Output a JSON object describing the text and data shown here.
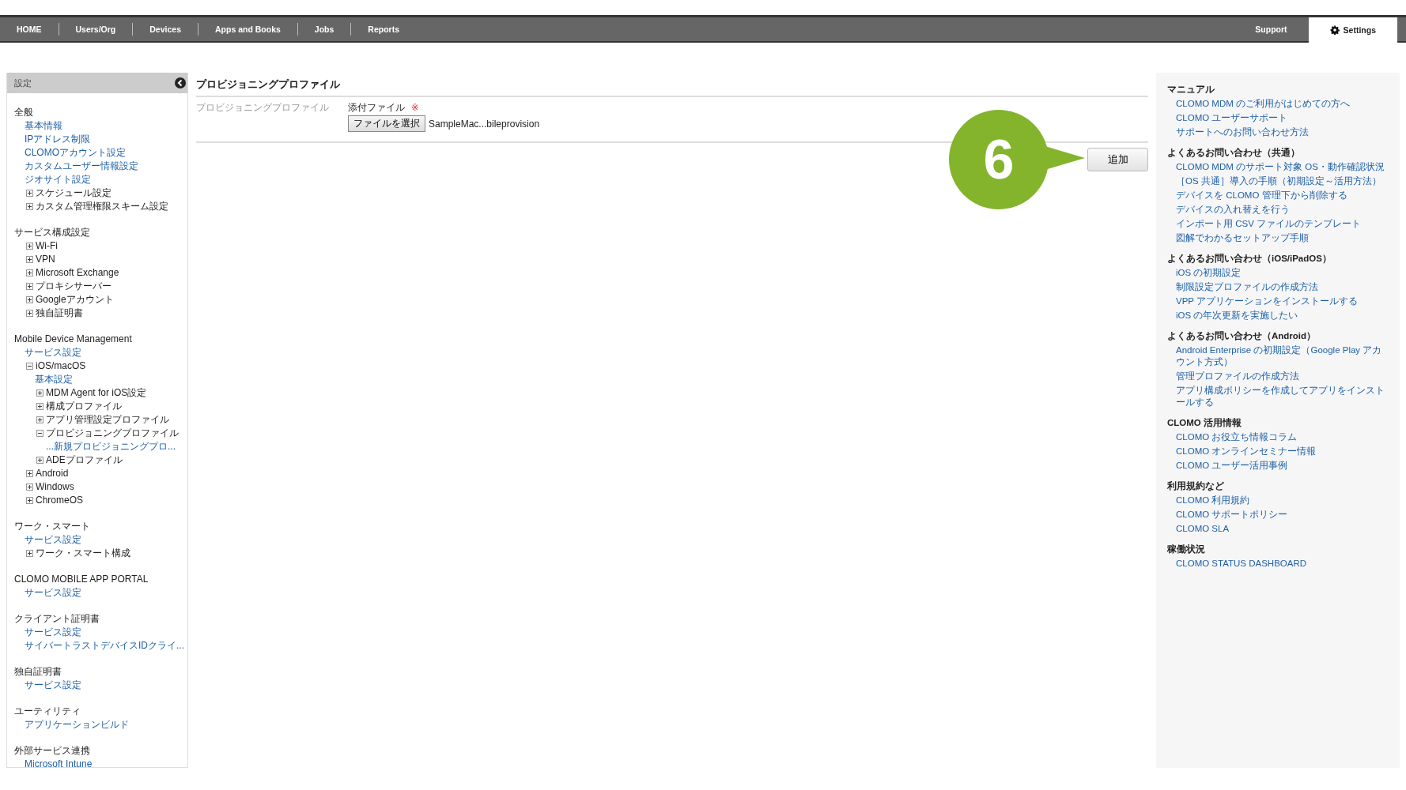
{
  "nav": {
    "tabs": [
      {
        "label": "HOME",
        "selected": false
      },
      {
        "label": "Users/Org",
        "selected": false
      },
      {
        "label": "Devices",
        "selected": false
      },
      {
        "label": "Apps and Books",
        "selected": false
      },
      {
        "label": "Jobs",
        "selected": false
      },
      {
        "label": "Reports",
        "selected": false
      }
    ],
    "right_tabs": [
      {
        "label": "Support",
        "selected": false,
        "kind": "plain"
      },
      {
        "label": "Settings",
        "selected": true,
        "kind": "settings"
      }
    ]
  },
  "sidebar": {
    "title": "設定",
    "sections": [
      {
        "title": "全般",
        "items": [
          {
            "kind": "link",
            "label": "基本情報"
          },
          {
            "kind": "link",
            "label": "IPアドレス制限"
          },
          {
            "kind": "link",
            "label": "CLOMOアカウント設定"
          },
          {
            "kind": "link",
            "label": "カスタムユーザー情報設定"
          },
          {
            "kind": "link",
            "label": "ジオサイト設定"
          },
          {
            "kind": "node",
            "label": "スケジュール設定",
            "expanded": false
          },
          {
            "kind": "node",
            "label": "カスタム管理権限スキーム設定",
            "expanded": false
          }
        ]
      },
      {
        "title": "サービス構成設定",
        "items": [
          {
            "kind": "node",
            "label": "Wi-Fi",
            "expanded": false
          },
          {
            "kind": "node",
            "label": "VPN",
            "expanded": false
          },
          {
            "kind": "node",
            "label": "Microsoft Exchange",
            "expanded": false
          },
          {
            "kind": "node",
            "label": "プロキシサーバー",
            "expanded": false
          },
          {
            "kind": "node",
            "label": "Googleアカウント",
            "expanded": false
          },
          {
            "kind": "node",
            "label": "独自証明書",
            "expanded": false
          }
        ]
      },
      {
        "title": "Mobile Device Management",
        "items": [
          {
            "kind": "link",
            "label": "サービス設定"
          },
          {
            "kind": "node",
            "label": "iOS/macOS",
            "expanded": true,
            "children": [
              {
                "kind": "link",
                "label": "基本設定"
              },
              {
                "kind": "node",
                "label": "MDM Agent for iOS設定",
                "expanded": false
              },
              {
                "kind": "node",
                "label": "構成プロファイル",
                "expanded": false
              },
              {
                "kind": "node",
                "label": "アプリ管理設定プロファイル",
                "expanded": false
              },
              {
                "kind": "node",
                "label": "プロビジョニングプロファイル",
                "expanded": true,
                "children": [
                  {
                    "kind": "link",
                    "label": "...新規プロビジョニングプロ..."
                  }
                ]
              },
              {
                "kind": "node",
                "label": "ADEプロファイル",
                "expanded": false
              }
            ]
          },
          {
            "kind": "node",
            "label": "Android",
            "expanded": false
          },
          {
            "kind": "node",
            "label": "Windows",
            "expanded": false
          },
          {
            "kind": "node",
            "label": "ChromeOS",
            "expanded": false
          }
        ]
      },
      {
        "title": "ワーク・スマート",
        "items": [
          {
            "kind": "link",
            "label": "サービス設定"
          },
          {
            "kind": "node",
            "label": "ワーク・スマート構成",
            "expanded": false
          }
        ]
      },
      {
        "title": "CLOMO MOBILE APP PORTAL",
        "items": [
          {
            "kind": "link",
            "label": "サービス設定"
          }
        ]
      },
      {
        "title": "クライアント証明書",
        "items": [
          {
            "kind": "link",
            "label": "サービス設定"
          },
          {
            "kind": "link",
            "label": "サイバートラストデバイスIDクライ..."
          }
        ]
      },
      {
        "title": "独自証明書",
        "items": [
          {
            "kind": "link",
            "label": "サービス設定"
          }
        ]
      },
      {
        "title": "ユーティリティ",
        "items": [
          {
            "kind": "link",
            "label": "アプリケーションビルド"
          }
        ]
      },
      {
        "title": "外部サービス連携",
        "items": [
          {
            "kind": "link",
            "label": "Microsoft Intune"
          }
        ]
      }
    ]
  },
  "main": {
    "title": "プロビジョニングプロファイル",
    "row_label": "プロビジョニングプロファイル",
    "field_label": "添付ファイル",
    "required_mark": "※",
    "file_button": "ファイルを選択",
    "file_name": "SampleMac...bileprovision",
    "add_button": "追加",
    "callout": "6"
  },
  "help": {
    "sections": [
      {
        "title": "マニュアル",
        "links": [
          "CLOMO MDM のご利用がはじめての方へ",
          "CLOMO ユーザーサポート",
          "サポートへのお問い合わせ方法"
        ]
      },
      {
        "title": "よくあるお問い合わせ（共通）",
        "links": [
          "CLOMO MDM のサポート対象 OS・動作確認状況",
          "［OS 共通］導入の手順（初期設定～活用方法）",
          "デバイスを CLOMO 管理下から削除する",
          "デバイスの入れ替えを行う",
          "インポート用 CSV ファイルのテンプレート",
          "図解でわかるセットアップ手順"
        ]
      },
      {
        "title": "よくあるお問い合わせ（iOS/iPadOS）",
        "links": [
          "iOS の初期設定",
          "制限設定プロファイルの作成方法",
          "VPP アプリケーションをインストールする",
          "iOS の年次更新を実施したい"
        ]
      },
      {
        "title": "よくあるお問い合わせ（Android）",
        "links": [
          "Android Enterprise の初期設定（Google Play アカウント方式）",
          "管理プロファイルの作成方法",
          "アプリ構成ポリシーを作成してアプリをインストールする"
        ]
      },
      {
        "title": "CLOMO 活用情報",
        "links": [
          "CLOMO お役立ち情報コラム",
          "CLOMO オンラインセミナー情報",
          "CLOMO ユーザー活用事例"
        ]
      },
      {
        "title": "利用規約など",
        "links": [
          "CLOMO 利用規約",
          "CLOMO サポートポリシー",
          "CLOMO SLA"
        ]
      },
      {
        "title": "稼働状況",
        "links": [
          "CLOMO STATUS DASHBOARD"
        ]
      }
    ]
  }
}
